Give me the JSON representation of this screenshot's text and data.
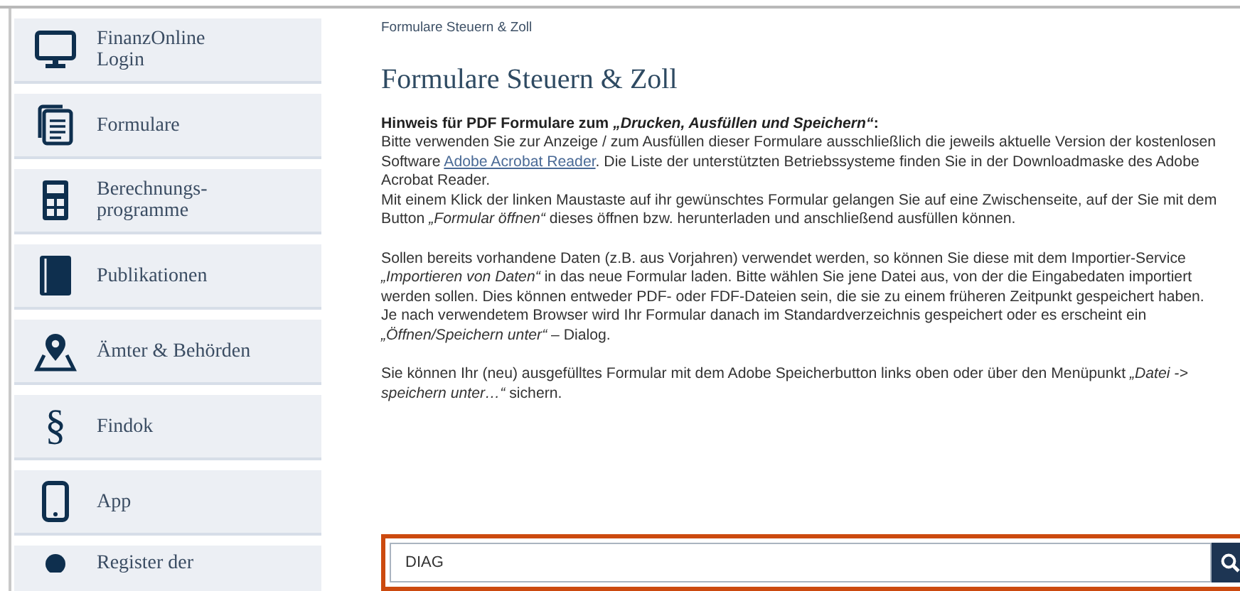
{
  "sidebar": {
    "items": [
      {
        "label": "FinanzOnline\nLogin"
      },
      {
        "label": "Formulare"
      },
      {
        "label": "Berechnungs-\nprogramme"
      },
      {
        "label": "Publikationen"
      },
      {
        "label": "Ämter & Behörden"
      },
      {
        "label": "Findok",
        "glyph": "§"
      },
      {
        "label": "App"
      },
      {
        "label": "Register der"
      }
    ]
  },
  "breadcrumb": "Formulare Steuern & Zoll",
  "title": "Formulare Steuern & Zoll",
  "notice": {
    "heading": "Hinweis für PDF Formulare zum *„Drucken, Ausfüllen und Speichern“*:",
    "paragraphs": [
      {
        "lines": [
          {
            "text": "Bitte verwenden Sie zur Anzeige / zum Ausfüllen dieser Formulare ausschließlich die jeweils aktuelle Version der kostenlosen Software ",
            "link": "Adobe Acrobat Reader",
            "after": ". Die Liste der unterstützten Betriebssysteme finden Sie in der Downloadmaske des Adobe Acrobat Reader."
          },
          {
            "text": "Mit einem Klick der linken Maustaste auf ihr gewünschtes Formular gelangen Sie auf eine Zwischenseite, auf der Sie mit dem Button *„Formular öffnen“*  dieses öffnen bzw. herunterladen und anschließend ausfüllen können."
          }
        ]
      },
      {
        "lines": [
          {
            "text": "Sollen bereits vorhandene Daten (z.B. aus Vorjahren) verwendet werden, so können Sie diese mit dem Importier-Service *„Importieren von Daten“* in das neue Formular laden. Bitte wählen Sie jene Datei aus, von der die Eingabedaten importiert werden sollen. Dies können entweder PDF- oder FDF-Dateien sein, die sie zu einem früheren Zeitpunkt gespeichert haben."
          },
          {
            "text": "Je nach verwendetem Browser wird Ihr Formular danach im Standardverzeichnis gespeichert oder es erscheint ein *„Öffnen/Speichern unter“*  – Dialog."
          }
        ]
      },
      {
        "lines": [
          {
            "text": "Sie können Ihr (neu) ausgefülltes Formular mit dem Adobe Speicherbutton links oben oder über den Menüpunkt *„Datei -> speichern unter…“* sichern."
          }
        ]
      }
    ]
  },
  "search": {
    "value": "DIAG"
  }
}
